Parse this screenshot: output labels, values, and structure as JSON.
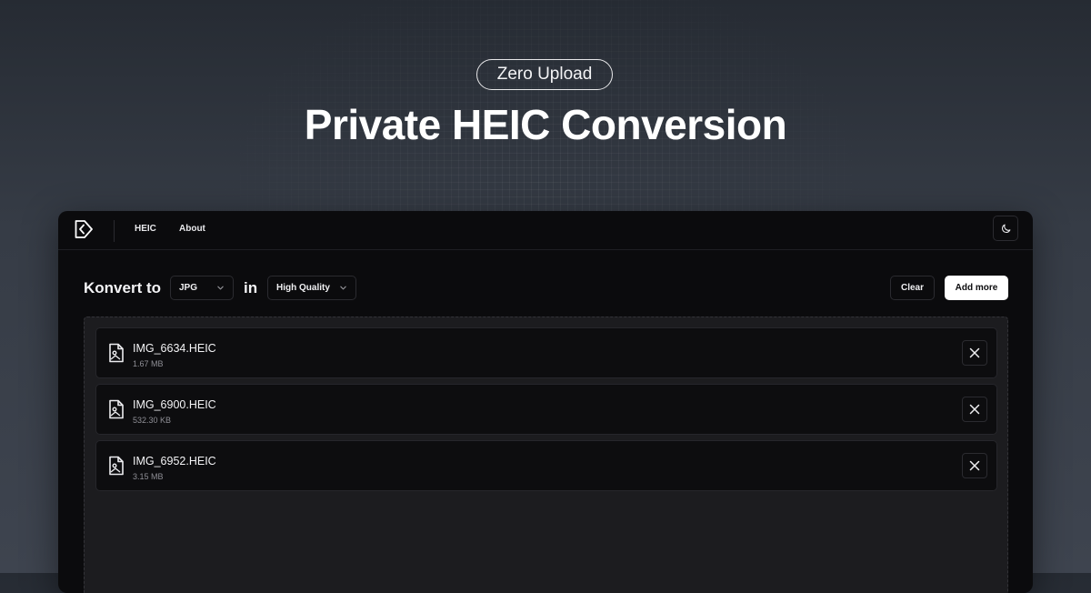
{
  "hero": {
    "badge": "Zero Upload",
    "headline": "Private HEIC Conversion"
  },
  "nav": {
    "logo_icon": "konvert-logo-icon",
    "links": [
      "HEIC",
      "About"
    ],
    "theme_toggle_icon": "moon-icon"
  },
  "toolbar": {
    "convert_label": "Konvert to",
    "format_select": "JPG",
    "in_label": "in",
    "quality_select": "High Quality",
    "clear_label": "Clear",
    "add_more_label": "Add more"
  },
  "files": [
    {
      "name": "IMG_6634.HEIC",
      "size": "1.67 MB"
    },
    {
      "name": "IMG_6900.HEIC",
      "size": "532.30 KB"
    },
    {
      "name": "IMG_6952.HEIC",
      "size": "3.15 MB"
    }
  ],
  "colors": {
    "app_bg": "#0b0b0d",
    "dropzone_bg": "#1c1c1f",
    "accent_button": "#ffffff"
  }
}
